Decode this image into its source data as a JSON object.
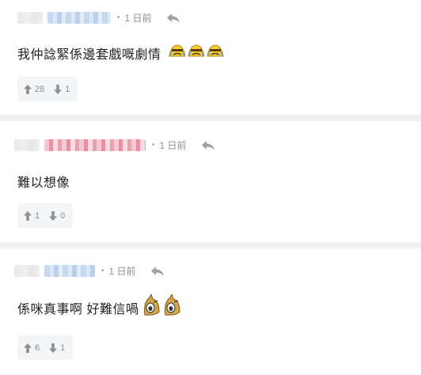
{
  "comments": [
    {
      "time": "1 日前",
      "text": "我仲諗緊係邊套戲嘅劇情",
      "upvotes": "28",
      "downvotes": "1",
      "emoji": "crying-face-icon"
    },
    {
      "time": "1 日前",
      "text": "難以想像",
      "upvotes": "1",
      "downvotes": "0"
    },
    {
      "time": "1 日前",
      "text": "係咪真事啊 好難信喎",
      "upvotes": "6",
      "downvotes": "1",
      "emoji": "shocked-face-icon"
    }
  ],
  "colors": {
    "separator": "#eef0f2",
    "vote_bg": "#f4f5f6",
    "meta": "#9aa0a6"
  }
}
